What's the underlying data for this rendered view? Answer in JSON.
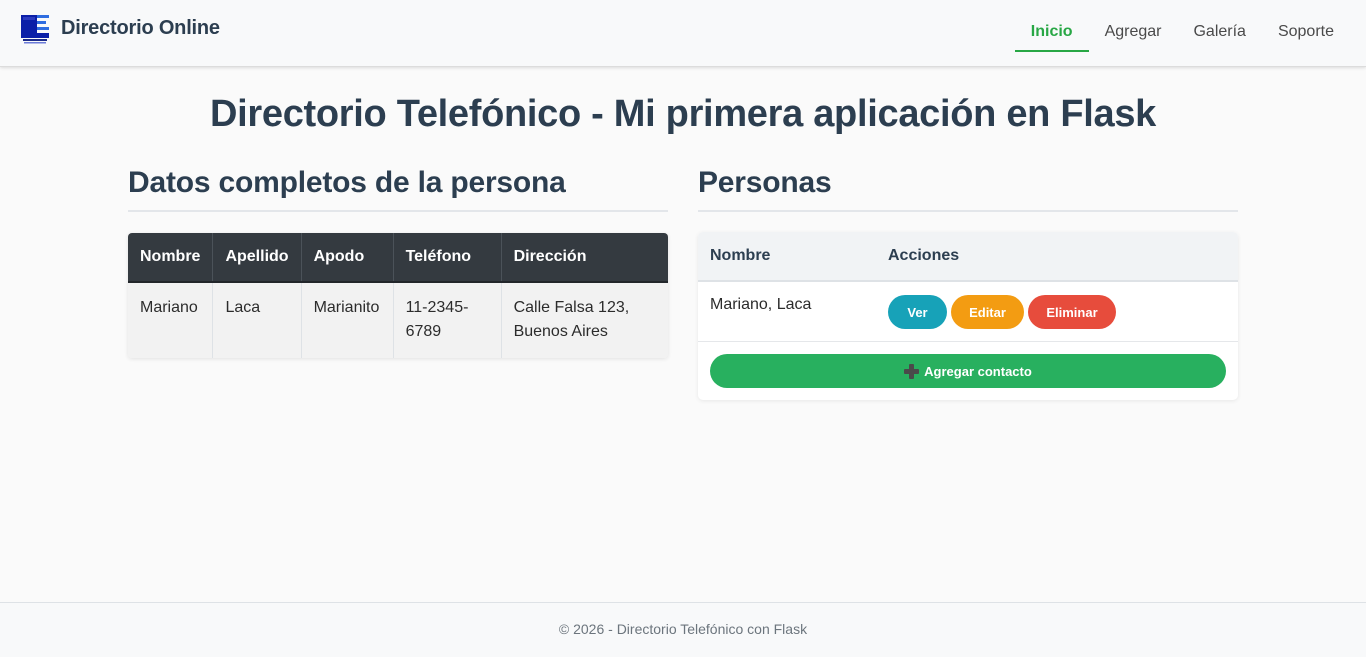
{
  "navbar": {
    "brand": "Directorio Online",
    "logo_icon": "contacts-logo-icon",
    "links": [
      {
        "label": "Inicio",
        "active": true
      },
      {
        "label": "Agregar",
        "active": false
      },
      {
        "label": "Galería",
        "active": false
      },
      {
        "label": "Soporte",
        "active": false
      }
    ]
  },
  "page": {
    "title": "Directorio Telefónico - Mi primera aplicación en Flask"
  },
  "details": {
    "title": "Datos completos de la persona",
    "columns": [
      "Nombre",
      "Apellido",
      "Apodo",
      "Teléfono",
      "Dirección"
    ],
    "row": {
      "nombre": "Mariano",
      "apellido": "Laca",
      "apodo": "Marianito",
      "telefono": "11-2345-6789",
      "direccion": "Calle Falsa 123, Buenos Aires"
    }
  },
  "persons": {
    "title": "Personas",
    "columns": [
      "Nombre",
      "Acciones"
    ],
    "rows": [
      {
        "name": "Mariano, Laca",
        "view_label": "Ver",
        "edit_label": "Editar",
        "delete_label": "Eliminar"
      }
    ],
    "add_label": "Agregar contacto",
    "add_icon": "plus-icon"
  },
  "footer": {
    "text": "© 2026 - Directorio Telefónico con Flask"
  },
  "colors": {
    "accent_green": "#28a745",
    "table_header": "#343a40",
    "btn_ver": "#17a2b8",
    "btn_editar": "#f39c12",
    "btn_eliminar": "#e74c3c",
    "btn_add": "#28b05f"
  }
}
